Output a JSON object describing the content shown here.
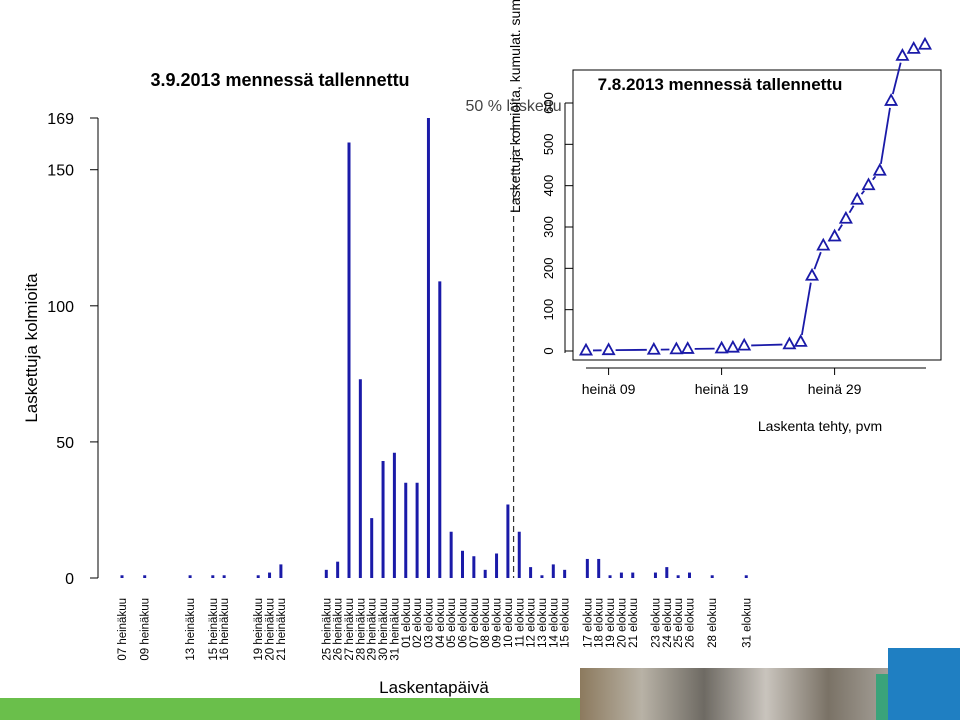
{
  "chart_data": [
    {
      "type": "bar",
      "title": "3.9.2013 mennessä tallennettu",
      "xlabel": "Laskentapäivä",
      "ylabel": "Laskettuja kolmioita",
      "yticks": [
        0,
        50,
        100,
        150,
        169
      ],
      "ylim": [
        0,
        169
      ],
      "annotation": "50 % laskettu",
      "annotation_x": 41.5,
      "color": "#1a1aa8",
      "categories": [
        "07 heinäkuu",
        "09 heinäkuu",
        "13 heinäkuu",
        "15 heinäkuu",
        "16 heinäkuu",
        "19 heinäkuu",
        "20 heinäkuu",
        "21 heinäkuu",
        "25 heinäkuu",
        "26 heinäkuu",
        "27 heinäkuu",
        "28 heinäkuu",
        "29 heinäkuu",
        "30 heinäkuu",
        "31 heinäkuu",
        "01 elokuu",
        "02 elokuu",
        "03 elokuu",
        "04 elokuu",
        "05 elokuu",
        "06 elokuu",
        "07 elokuu",
        "08 elokuu",
        "09 elokuu",
        "10 elokuu",
        "11 elokuu",
        "12 elokuu",
        "13 elokuu",
        "14 elokuu",
        "15 elokuu",
        "17 elokuu",
        "18 elokuu",
        "19 elokuu",
        "20 elokuu",
        "21 elokuu",
        "23 elokuu",
        "24 elokuu",
        "25 elokuu",
        "26 elokuu",
        "28 elokuu",
        "31 elokuu"
      ],
      "x": [
        7,
        9,
        13,
        15,
        16,
        19,
        20,
        21,
        25,
        26,
        27,
        28,
        29,
        30,
        31,
        32,
        33,
        34,
        35,
        36,
        37,
        38,
        39,
        40,
        41,
        42,
        43,
        44,
        45,
        46,
        48,
        49,
        50,
        51,
        52,
        54,
        55,
        56,
        57,
        59,
        62
      ],
      "values": [
        1,
        1,
        1,
        1,
        1,
        1,
        2,
        5,
        3,
        6,
        160,
        73,
        22,
        43,
        46,
        35,
        35,
        169,
        109,
        17,
        10,
        8,
        3,
        9,
        27,
        17,
        4,
        1,
        5,
        3,
        7,
        7,
        1,
        2,
        2,
        2,
        4,
        1,
        2,
        1,
        1
      ]
    },
    {
      "type": "line",
      "title": "7.8.2013 mennessä tallennettu",
      "xlabel": "Laskenta tehty, pvm",
      "ylabel": "Laskettuja kolmioita, kumulat. sum",
      "yticks": [
        0,
        100,
        200,
        300,
        400,
        500,
        600
      ],
      "ylim": [
        0,
        600
      ],
      "xtick_labels": [
        "heinä 09",
        "heinä 19",
        "heinä 29"
      ],
      "xtick_positions": [
        9,
        19,
        29
      ],
      "marker": "triangle",
      "color": "#1a1aa8",
      "x": [
        7,
        9,
        13,
        15,
        16,
        19,
        20,
        21,
        25,
        26,
        27,
        28,
        29,
        30,
        31,
        32,
        33,
        34,
        35,
        36,
        37
      ],
      "values": [
        1,
        2,
        3,
        4,
        5,
        6,
        8,
        13,
        16,
        22,
        182,
        255,
        277,
        320,
        366,
        401,
        436,
        605,
        714,
        731,
        741
      ]
    }
  ],
  "footer": {
    "green": "#6abf4b",
    "blue": "#1f7fc2"
  }
}
